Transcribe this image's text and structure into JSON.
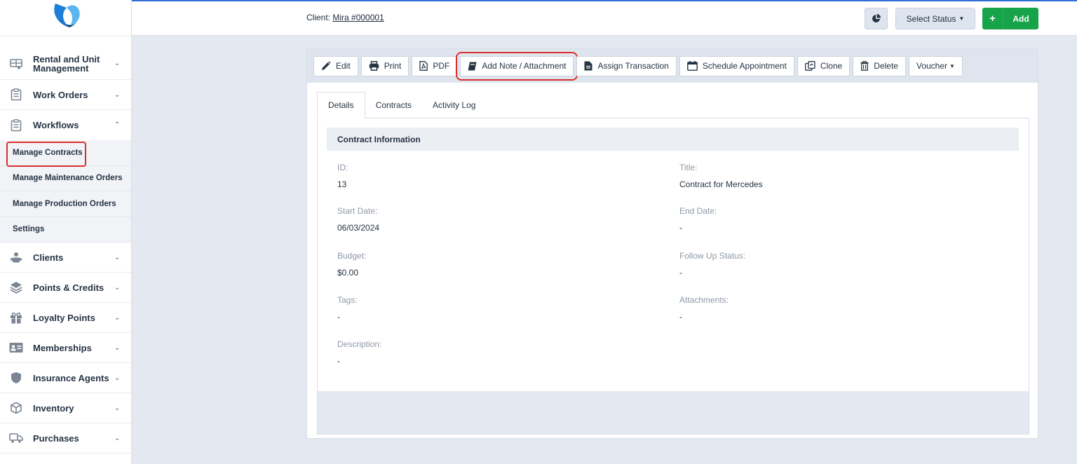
{
  "sidebar": {
    "items_top": [
      {
        "label": "Rental and Unit Management",
        "icon": "rental-icon",
        "chev": "⌄"
      },
      {
        "label": "Work Orders",
        "icon": "clipboard-icon",
        "chev": "⌄"
      },
      {
        "label": "Workflows",
        "icon": "clipboard-icon",
        "chev": "⌃"
      }
    ],
    "submenu": [
      {
        "label": "Manage Contracts"
      },
      {
        "label": "Manage Maintenance Orders"
      },
      {
        "label": "Manage Production Orders"
      },
      {
        "label": "Settings"
      }
    ],
    "items_bottom": [
      {
        "label": "Clients",
        "icon": "clients-icon"
      },
      {
        "label": "Points & Credits",
        "icon": "layers-icon"
      },
      {
        "label": "Loyalty Points",
        "icon": "gift-icon"
      },
      {
        "label": "Memberships",
        "icon": "id-card-icon"
      },
      {
        "label": "Insurance Agents",
        "icon": "shield-icon"
      },
      {
        "label": "Inventory",
        "icon": "box-icon"
      },
      {
        "label": "Purchases",
        "icon": "truck-icon"
      }
    ]
  },
  "topbar": {
    "client_prefix": "Client: ",
    "client_link": "Mira #000001",
    "status_label": "Select Status",
    "add_label": "Add"
  },
  "toolbar": {
    "edit": "Edit",
    "print": "Print",
    "pdf": "PDF",
    "add_note": "Add Note / Attachment",
    "assign_transaction": "Assign Transaction",
    "schedule": "Schedule Appointment",
    "clone": "Clone",
    "delete": "Delete",
    "voucher": "Voucher"
  },
  "tabs": [
    "Details",
    "Contracts",
    "Activity Log"
  ],
  "section_title": "Contract Information",
  "fields": {
    "id": {
      "label": "ID:",
      "value": "13"
    },
    "title": {
      "label": "Title:",
      "value": "Contract for Mercedes"
    },
    "start_date": {
      "label": "Start Date:",
      "value": "06/03/2024"
    },
    "end_date": {
      "label": "End Date:",
      "value": "-"
    },
    "budget": {
      "label": "Budget:",
      "value": "$0.00"
    },
    "follow_up": {
      "label": "Follow Up Status:",
      "value": "-"
    },
    "tags": {
      "label": "Tags:",
      "value": "-"
    },
    "attachments": {
      "label": "Attachments:",
      "value": "-"
    },
    "description": {
      "label": "Description:",
      "value": "-"
    }
  },
  "colors": {
    "accent": "#2f6fd6",
    "add_green": "#17a34a",
    "highlight_red": "#d9302c"
  }
}
